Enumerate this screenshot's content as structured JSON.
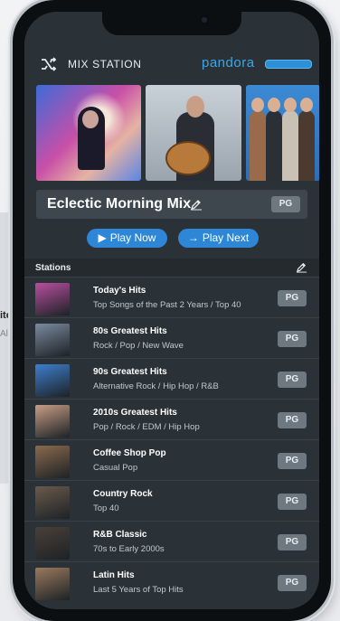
{
  "header": {
    "title": "MIX STATION",
    "brand": "pandora"
  },
  "mix": {
    "name": "Eclectic Morning Mix",
    "badge": "PG"
  },
  "actions": {
    "play_now": "Play Now",
    "play_next": "Play Next"
  },
  "stations_header": "Stations",
  "stations": [
    {
      "name": "Today's Hits",
      "desc": "Top Songs of the Past 2 Years / Top 40",
      "badge": "PG",
      "thumb_color": "#b84fa0"
    },
    {
      "name": "80s Greatest Hits",
      "desc": "Rock / Pop / New Wave",
      "badge": "PG",
      "thumb_color": "#7a8aa0"
    },
    {
      "name": "90s Greatest Hits",
      "desc": "Alternative Rock / Hip Hop / R&B",
      "badge": "PG",
      "thumb_color": "#3d7fcf"
    },
    {
      "name": "2010s Greatest Hits",
      "desc": "Pop / Rock / EDM / Hip Hop",
      "badge": "PG",
      "thumb_color": "#c79e86"
    },
    {
      "name": "Coffee Shop Pop",
      "desc": "Casual Pop",
      "badge": "PG",
      "thumb_color": "#8a6a4e"
    },
    {
      "name": "Country Rock",
      "desc": "Top 40",
      "badge": "PG",
      "thumb_color": "#6a5a4c"
    },
    {
      "name": "R&B Classic",
      "desc": "70s to Early 2000s",
      "badge": "PG",
      "thumb_color": "#4a4038"
    },
    {
      "name": "Latin Hits",
      "desc": "Last 5 Years of Top Hits",
      "badge": "PG",
      "thumb_color": "#9a7a5e"
    }
  ],
  "background_page": {
    "fragment1": "ite",
    "fragment2": "All"
  },
  "colors": {
    "accent": "#2d86d6",
    "screen_bg": "#2b3237",
    "brand": "#3ba6e6"
  }
}
